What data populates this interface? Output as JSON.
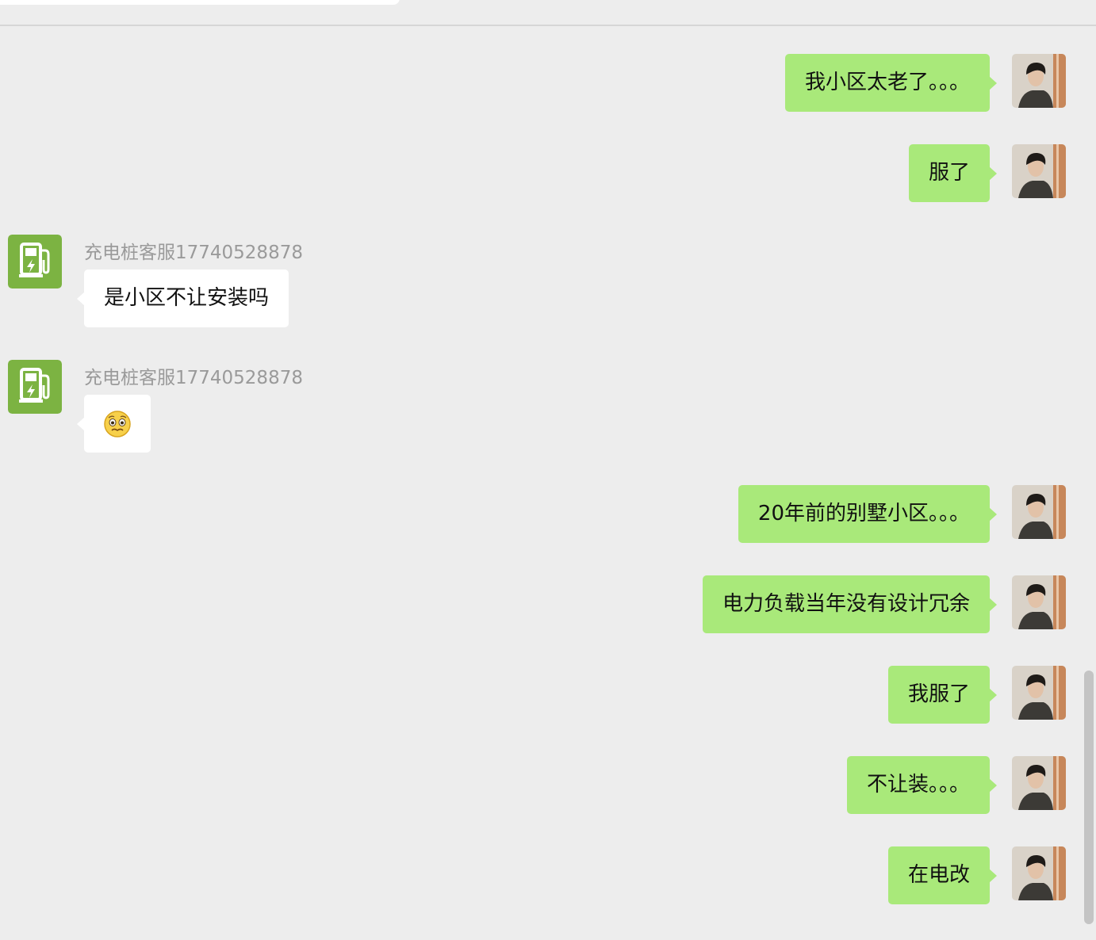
{
  "header": {
    "search_placeholder": ""
  },
  "contact": {
    "name": "充电桩客服17740528878"
  },
  "messages": [
    {
      "from": "me",
      "text": "我小区太老了。。。"
    },
    {
      "from": "me",
      "text": "服了"
    },
    {
      "from": "contact",
      "sender": "充电桩客服17740528878",
      "text": "是小区不让安装吗"
    },
    {
      "from": "contact",
      "sender": "充电桩客服17740528878",
      "emoji": "worried-face"
    },
    {
      "from": "me",
      "text": "20年前的别墅小区。。。"
    },
    {
      "from": "me",
      "text": "电力负载当年没有设计冗余"
    },
    {
      "from": "me",
      "text": "我服了"
    },
    {
      "from": "me",
      "text": "不让装。。。"
    },
    {
      "from": "me",
      "text": "在电改"
    }
  ],
  "colors": {
    "background": "#ededed",
    "my_bubble": "#a9e97a",
    "contact_bubble": "#ffffff",
    "sender_name": "#9a9a9a",
    "bot_avatar": "#7cb342"
  }
}
